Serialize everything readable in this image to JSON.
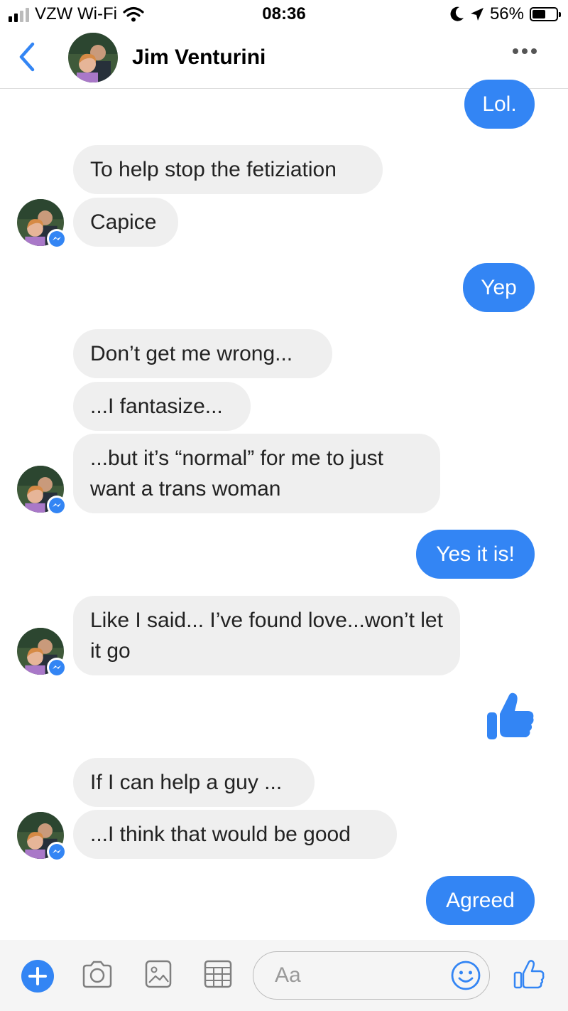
{
  "status_bar": {
    "carrier": "VZW Wi-Fi",
    "time": "08:36",
    "battery_percent": "56%",
    "battery_level": 0.56,
    "icons": [
      "signal-icon",
      "wifi-icon",
      "moon-icon",
      "location-arrow-icon",
      "battery-icon"
    ]
  },
  "header": {
    "contact_name": "Jim Venturini",
    "back_icon": "chevron-left-icon",
    "more_icon": "more-dots-icon"
  },
  "messages": [
    {
      "from": "me",
      "text": "Lol."
    },
    {
      "from": "them",
      "text": "To help stop the fetiziation"
    },
    {
      "from": "them",
      "text": "Capice"
    },
    {
      "from": "me",
      "text": "Yep"
    },
    {
      "from": "them",
      "text": "Don’t get me wrong..."
    },
    {
      "from": "them",
      "text": "...I fantasize..."
    },
    {
      "from": "them",
      "text": "...but it’s “normal” for me to just want a trans woman"
    },
    {
      "from": "me",
      "text": "Yes it is!"
    },
    {
      "from": "them",
      "text": "Like I said... I’ve found love...won’t let it go"
    },
    {
      "from": "me",
      "type": "thumbs-up-icon"
    },
    {
      "from": "them",
      "text": "If I can help a guy ..."
    },
    {
      "from": "them",
      "text": "...I think that would be good"
    },
    {
      "from": "me",
      "text": "Agreed"
    }
  ],
  "composer": {
    "placeholder": "Aa",
    "icons": [
      "plus-icon",
      "camera-icon",
      "image-icon",
      "grid-icon",
      "emoji-icon",
      "thumbs-up-icon"
    ]
  },
  "colors": {
    "accent": "#3385f4",
    "incoming_bubble": "#efefef",
    "incoming_text": "#222222",
    "outgoing_text": "#ffffff"
  }
}
